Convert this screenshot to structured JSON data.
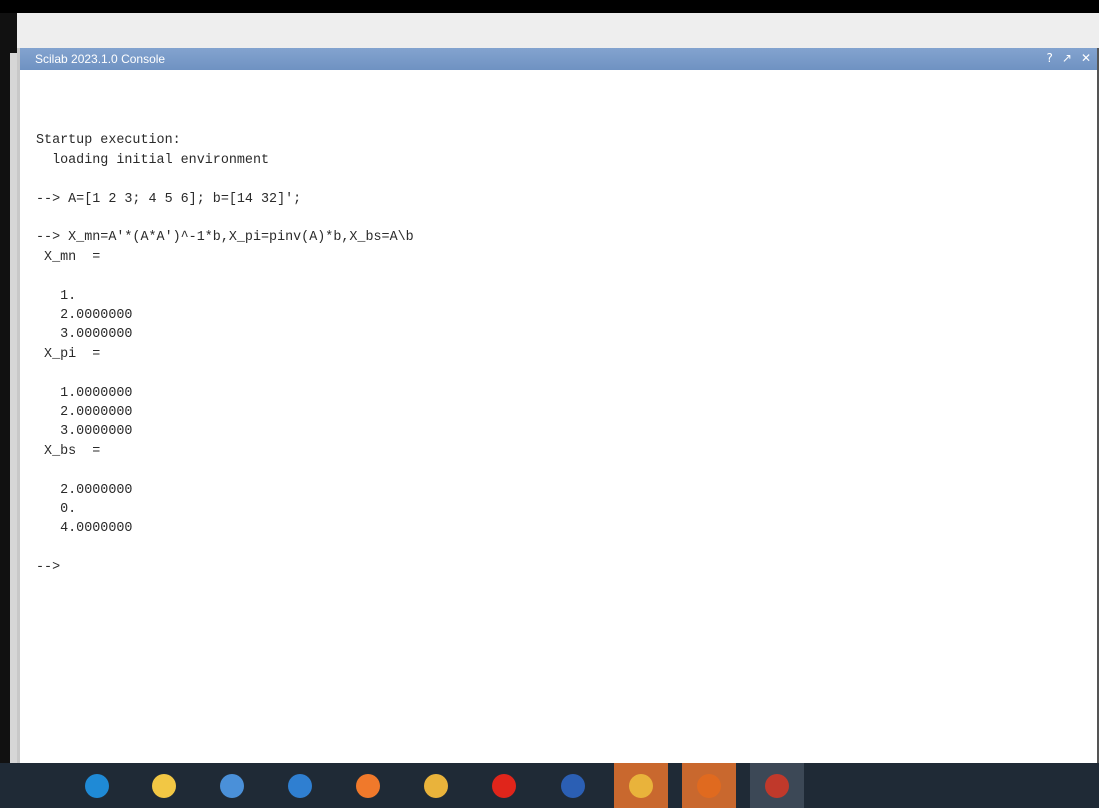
{
  "window": {
    "title": "Scilab 2023.1.0 Console",
    "controls": {
      "help": "?",
      "undock": "↗",
      "close": "✕"
    }
  },
  "console": {
    "lines": [
      "",
      "Startup execution:",
      "  loading initial environment",
      "",
      "--> A=[1 2 3; 4 5 6]; b=[14 32]';",
      "",
      "--> X_mn=A'*(A*A')^-1*b,X_pi=pinv(A)*b,X_bs=A\\b",
      " X_mn  =",
      "",
      "   1.",
      "   2.0000000",
      "   3.0000000",
      " X_pi  =",
      "",
      "   1.0000000",
      "   2.0000000",
      "   3.0000000",
      " X_bs  =",
      "",
      "   2.0000000",
      "   0.",
      "   4.0000000",
      "",
      "-->"
    ]
  },
  "taskbar": {
    "items": [
      {
        "icon": "edge-icon",
        "color": "#1f8ad6"
      },
      {
        "icon": "file-explorer-icon",
        "color": "#f2c744"
      },
      {
        "icon": "store-icon",
        "color": "#4a90d9"
      },
      {
        "icon": "mail-icon",
        "color": "#2f7fd1"
      },
      {
        "icon": "firefox-icon",
        "color": "#f0792b"
      },
      {
        "icon": "chrome-icon",
        "color": "#e9b33b"
      },
      {
        "icon": "opera-icon",
        "color": "#e0251b"
      },
      {
        "icon": "word-icon",
        "color": "#2b5fb4"
      },
      {
        "icon": "chrome-icon",
        "color": "#e9b33b"
      },
      {
        "icon": "matlab-icon",
        "color": "#e06a1f"
      },
      {
        "icon": "scilab-icon",
        "color": "#c0392b"
      }
    ]
  }
}
